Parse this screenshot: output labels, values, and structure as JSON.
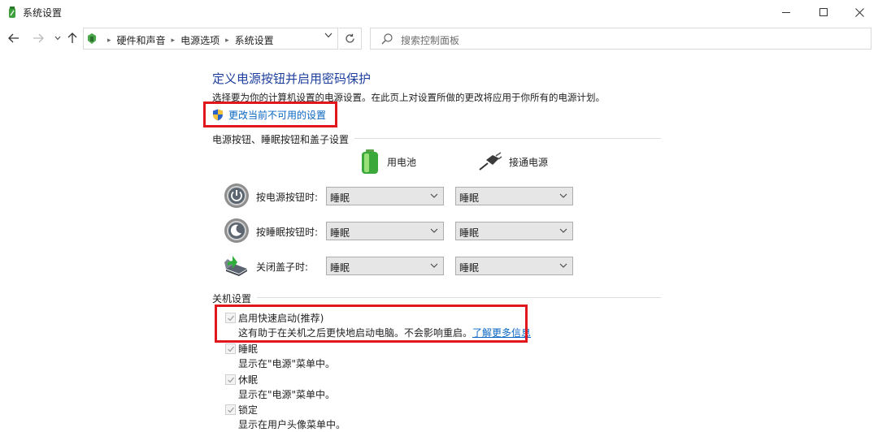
{
  "window": {
    "title": "系统设置"
  },
  "address": {
    "crumbs": [
      "硬件和声音",
      "电源选项",
      "系统设置"
    ]
  },
  "search": {
    "placeholder": "搜索控制面板"
  },
  "main": {
    "heading": "定义电源按钮并启用密码保护",
    "description": "选择要为你的计算机设置的电源设置。在此页上对设置所做的更改将应用于你所有的电源计划。",
    "change_link": "更改当前不可用的设置"
  },
  "power_section": {
    "title": "电源按钮、睡眠按钮和盖子设置",
    "columns": {
      "battery": "用电池",
      "plugged": "接通电源"
    },
    "rows": [
      {
        "label": "按电源按钮时:",
        "battery": "睡眠",
        "plugged": "睡眠",
        "icon": "power-button-icon"
      },
      {
        "label": "按睡眠按钮时:",
        "battery": "睡眠",
        "plugged": "睡眠",
        "icon": "sleep-button-icon"
      },
      {
        "label": "关闭盖子时:",
        "battery": "睡眠",
        "plugged": "睡眠",
        "icon": "laptop-lid-icon"
      }
    ]
  },
  "shutdown_section": {
    "title": "关机设置",
    "items": [
      {
        "title": "启用快速启动(推荐)",
        "subtitle": "这有助于在关机之后更快地启动电脑。不会影响重启。",
        "link": "了解更多信息",
        "checked": true
      },
      {
        "title": "睡眠",
        "subtitle": "显示在\"电源\"菜单中。",
        "checked": true
      },
      {
        "title": "休眠",
        "subtitle": "显示在\"电源\"菜单中。",
        "checked": true
      },
      {
        "title": "锁定",
        "subtitle": "显示在用户头像菜单中。",
        "checked": true
      }
    ]
  },
  "colors": {
    "heading": "#1e3f9e",
    "link": "#0a66c2",
    "highlight": "#e0181d"
  }
}
